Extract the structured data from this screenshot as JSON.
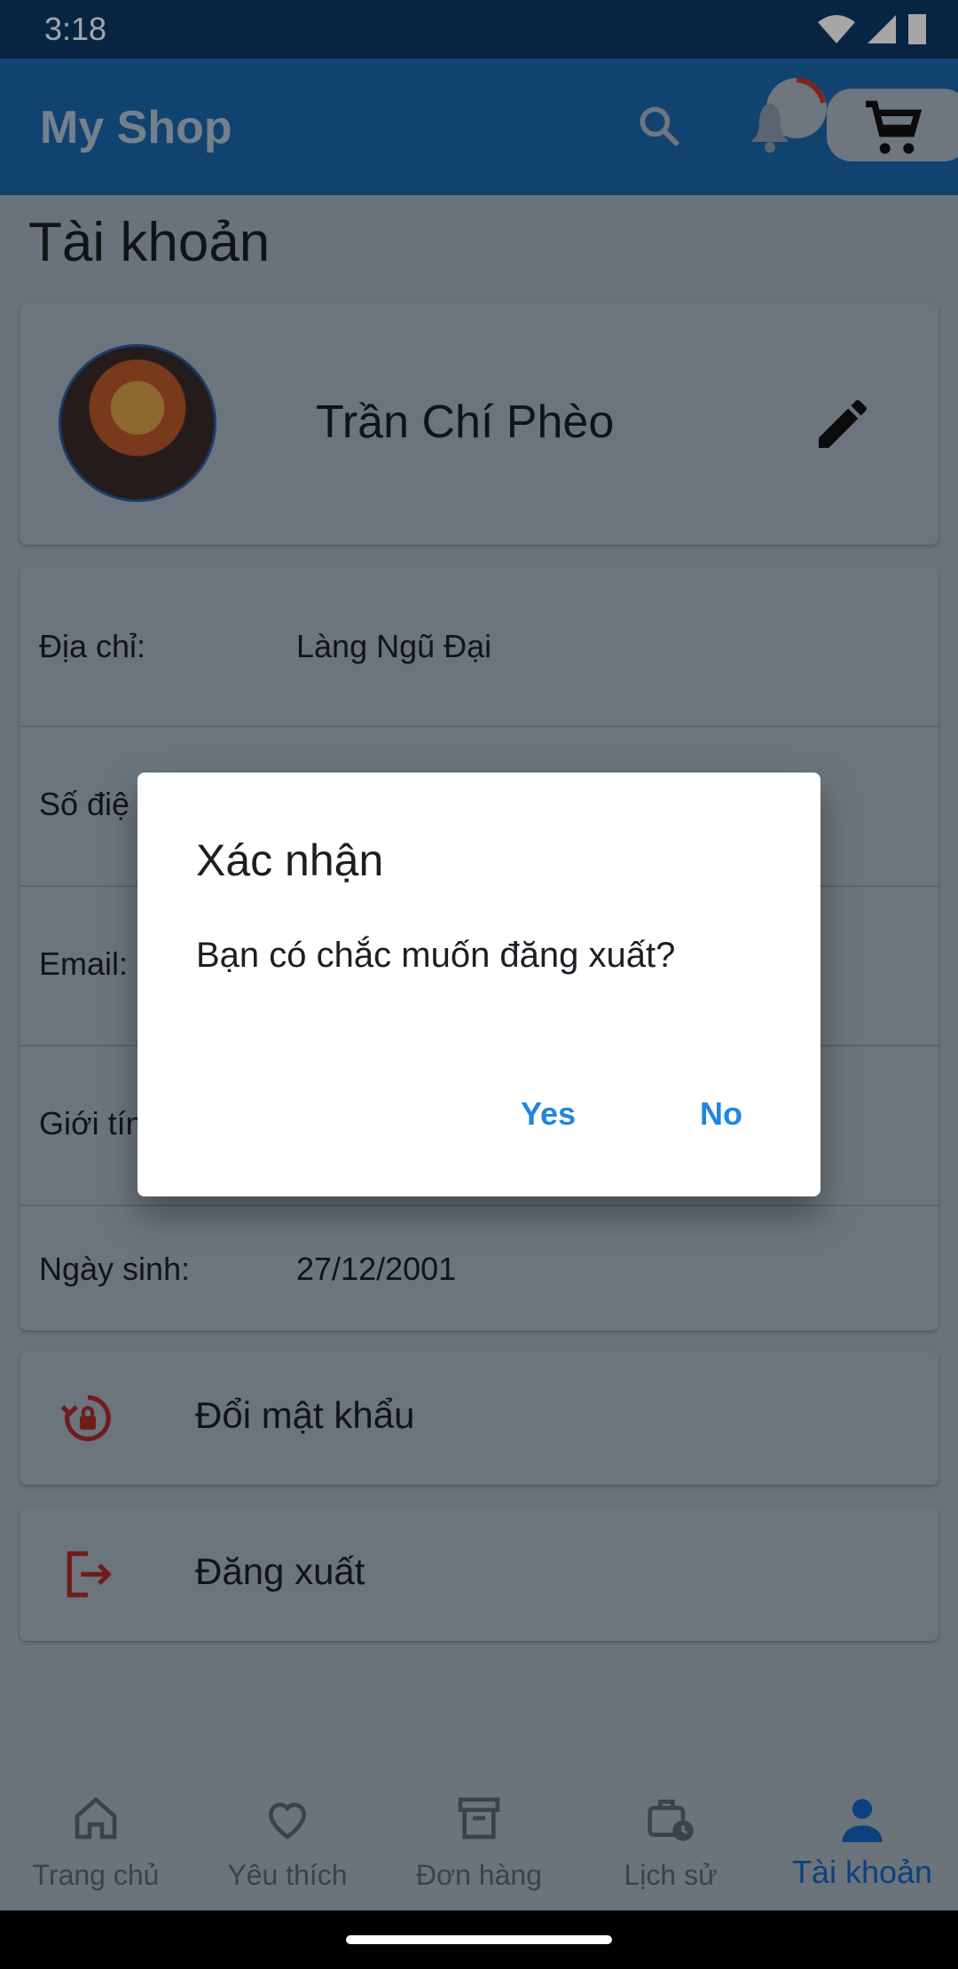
{
  "status_bar": {
    "time": "3:18"
  },
  "app_bar": {
    "title": "My Shop"
  },
  "page": {
    "title": "Tài khoản"
  },
  "profile": {
    "name": "Trần Chí Phèo"
  },
  "info_rows": [
    {
      "label": "Địa chỉ:",
      "value": "Làng Ngũ Đại"
    },
    {
      "label": "Số điệ",
      "value": ""
    },
    {
      "label": "Email:",
      "value": ""
    },
    {
      "label": "Giới tín",
      "value": ""
    },
    {
      "label": "Ngày sinh:",
      "value": "27/12/2001"
    }
  ],
  "actions": {
    "change_password": "Đổi mật khẩu",
    "logout": "Đăng xuất"
  },
  "bottom_nav": [
    {
      "label": "Trang chủ",
      "icon": "home-icon"
    },
    {
      "label": "Yêu thích",
      "icon": "heart-icon"
    },
    {
      "label": "Đơn hàng",
      "icon": "archive-icon"
    },
    {
      "label": "Lịch sử",
      "icon": "history-icon"
    },
    {
      "label": "Tài khoản",
      "icon": "person-icon"
    }
  ],
  "dialog": {
    "title": "Xác nhận",
    "message": "Bạn có chắc muốn đăng xuất?",
    "yes_label": "Yes",
    "no_label": "No"
  },
  "colors": {
    "primary": "#1b67ac",
    "accent": "#1f86e0",
    "active_nav": "#1565c0",
    "danger_icon": "#c62828"
  }
}
